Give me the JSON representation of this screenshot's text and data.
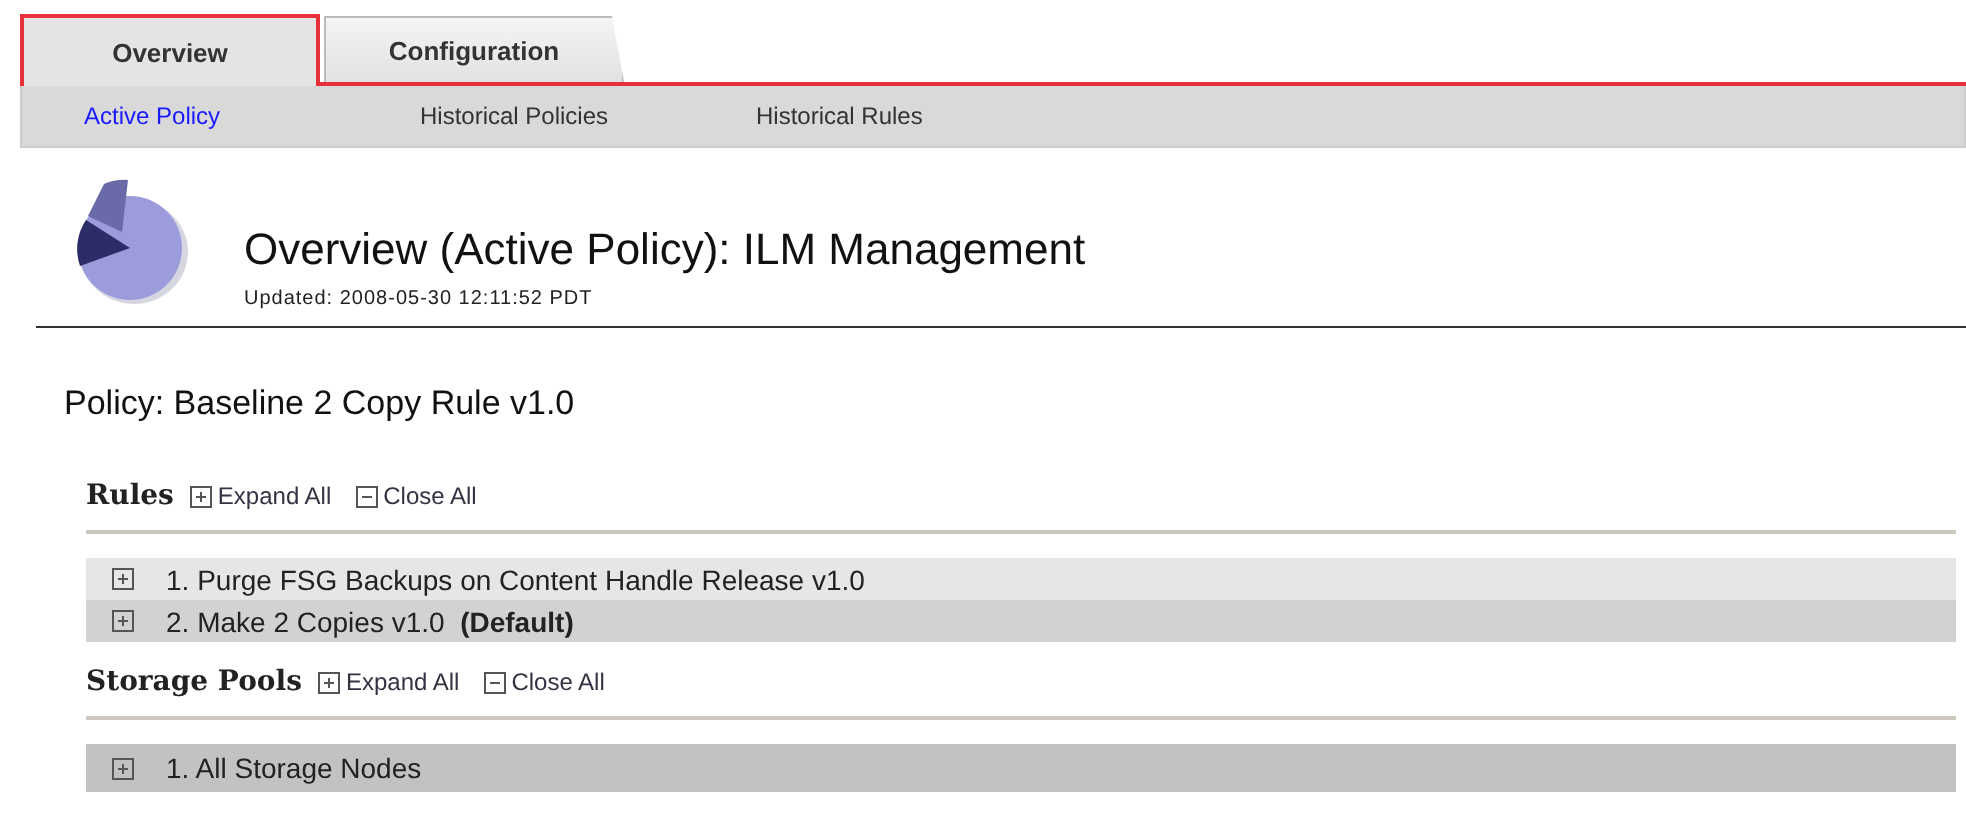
{
  "tabs": [
    {
      "label": "Overview",
      "selected": true
    },
    {
      "label": "Configuration",
      "selected": false
    }
  ],
  "subtabs": [
    {
      "label": "Active Policy",
      "selected": true
    },
    {
      "label": "Historical Policies",
      "selected": false
    },
    {
      "label": "Historical Rules",
      "selected": false
    }
  ],
  "header": {
    "title": "Overview (Active Policy): ILM Management",
    "updated": "Updated: 2008-05-30 12:11:52 PDT"
  },
  "policy_title": "Policy: Baseline 2 Copy Rule v1.0",
  "sections": [
    {
      "title": "Rules",
      "expand_all": "Expand All",
      "close_all": "Close All",
      "items": [
        {
          "label": "1. Purge FSG Backups on Content Handle Release v1.0",
          "expanded": false
        },
        {
          "label": "2. Make 2 Copies v1.0  **(Default)**",
          "expanded": false
        }
      ]
    },
    {
      "title": "Storage Pools",
      "expand_all": "Expand All",
      "close_all": "Close All",
      "items": [
        {
          "label": "1. All Storage Nodes",
          "expanded": false
        }
      ]
    }
  ]
}
